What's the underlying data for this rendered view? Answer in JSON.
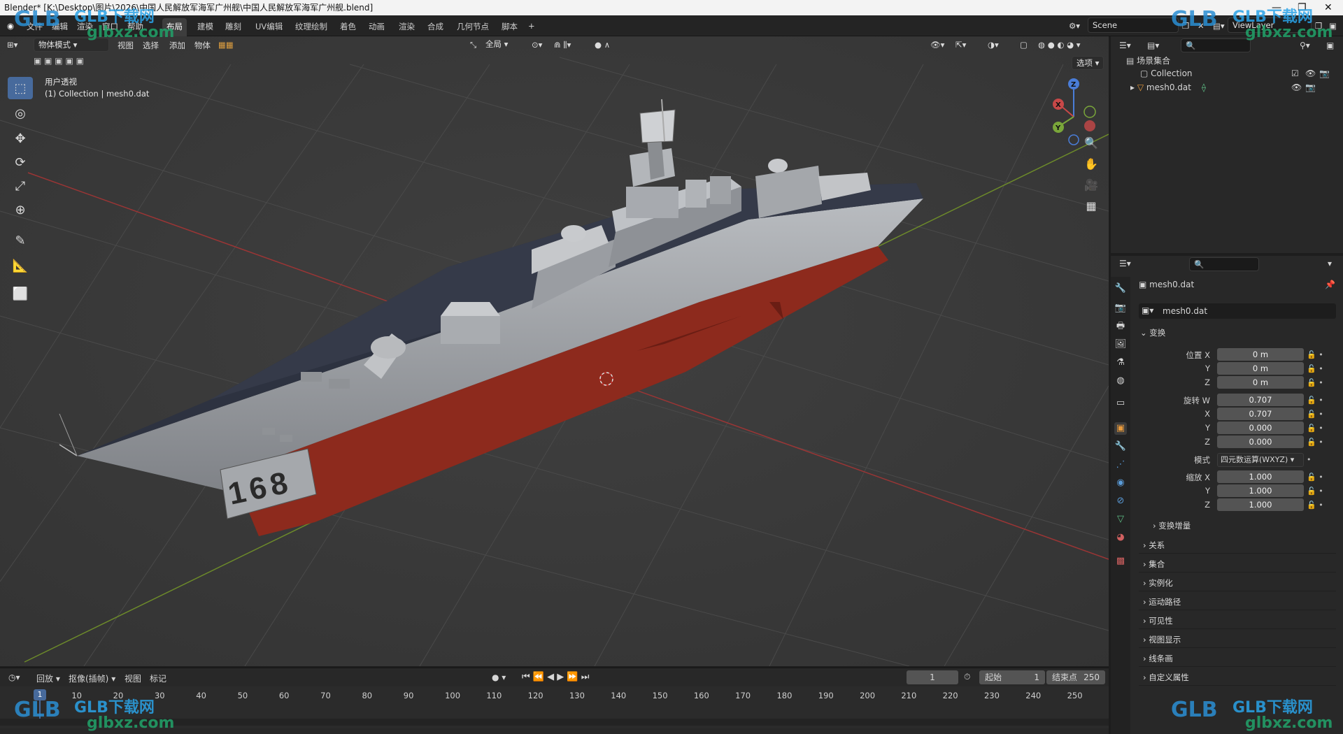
{
  "titlebar": {
    "text": "Blender* [K:\\Desktop\\图片\\2026\\中国人民解放军海军广州舰\\中国人民解放军海军广州舰.blend]"
  },
  "menu": [
    "文件",
    "编辑",
    "渲染",
    "窗口",
    "帮助"
  ],
  "workspaces": [
    "布局",
    "建模",
    "雕刻",
    "UV编辑",
    "纹理绘制",
    "着色",
    "动画",
    "渲染",
    "合成",
    "几何节点",
    "脚本",
    "+"
  ],
  "scene": {
    "label": "Scene",
    "view_layer": "ViewLayer"
  },
  "viewport_header": {
    "mode": "物体模式",
    "view": "视图",
    "select": "选择",
    "add": "添加",
    "object": "物体",
    "orientation": "全局",
    "options": "选项"
  },
  "viewport_overlay": {
    "view_name": "用户透视",
    "collection": "(1) Collection | mesh0.dat"
  },
  "ship": {
    "hull_number": "168"
  },
  "gizmo": {
    "z": "Z",
    "x": "X",
    "y": "Y"
  },
  "outliner": {
    "root": "场景集合",
    "items": [
      {
        "label": "Collection"
      },
      {
        "label": "mesh0.dat"
      }
    ]
  },
  "properties": {
    "object_name": "mesh0.dat",
    "object_field": "mesh0.dat",
    "transform": "变换",
    "location": {
      "label": "位置 X",
      "x": "0 m",
      "y": "0 m",
      "z": "0 m"
    },
    "rotation": {
      "label": "旋转 W",
      "w": "0.707",
      "x": "0.707",
      "y": "0.000",
      "z": "0.000"
    },
    "mode": {
      "label": "模式",
      "value": "四元数运算(WXYZ)"
    },
    "scale": {
      "label": "缩放 X",
      "x": "1.000",
      "y": "1.000",
      "z": "1.000"
    },
    "axis_y": "Y",
    "axis_z": "Z",
    "axis_x": "X",
    "delta": "变换增量",
    "sections": [
      "关系",
      "集合",
      "实例化",
      "运动路径",
      "可见性",
      "视图显示",
      "线条画",
      "自定义属性"
    ]
  },
  "timeline": {
    "playback": "回放",
    "keying": "抠像(插帧)",
    "view": "视图",
    "marker": "标记",
    "current_frame": "1",
    "start_label": "起始",
    "start": "1",
    "end_label": "结束点",
    "end": "250",
    "ticks": [
      "1",
      "10",
      "20",
      "30",
      "40",
      "50",
      "60",
      "70",
      "80",
      "90",
      "100",
      "110",
      "120",
      "130",
      "140",
      "150",
      "160",
      "170",
      "180",
      "190",
      "200",
      "210",
      "220",
      "230",
      "240",
      "250"
    ]
  },
  "watermark": {
    "brand": "GLB下载网",
    "url": "glbxz.com",
    "logo": "GLB"
  }
}
